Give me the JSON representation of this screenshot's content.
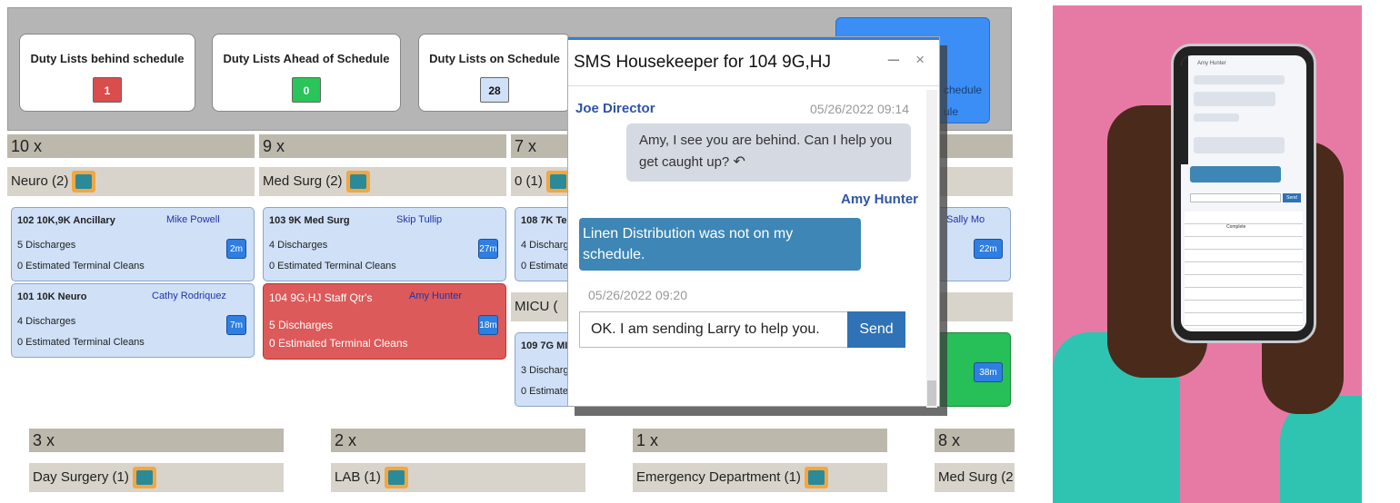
{
  "stats": [
    {
      "label": "Duty Lists behind schedule",
      "count": "1",
      "color": "#d94d4d"
    },
    {
      "label": "Duty Lists Ahead of Schedule",
      "count": "0",
      "color": "#29c45a"
    },
    {
      "label": "Duty Lists on Schedule",
      "count": "28",
      "color": "#cfe0f7"
    }
  ],
  "blue_button": {
    "line1": "chedule",
    "line2": "ule"
  },
  "groups": [
    {
      "multiplier": "10 x",
      "unit": "Neuro (2)"
    },
    {
      "multiplier": "9 x",
      "unit": "Med Surg (2)"
    },
    {
      "multiplier": "7 x",
      "unit": "0 (1)"
    }
  ],
  "lower_groups": [
    {
      "multiplier": "3 x",
      "unit": "Day Surgery (1)"
    },
    {
      "multiplier": "2 x",
      "unit": "LAB (1)"
    },
    {
      "multiplier": "1 x",
      "unit": "Emergency Department (1)"
    },
    {
      "multiplier": "8 x",
      "unit": "Med Surg (2"
    }
  ],
  "micu_label": "MICU (",
  "cards": [
    {
      "title": "102 10K,9K Ancillary",
      "who": "Mike Powell",
      "line1": "5 Discharges",
      "line2": "0 Estimated Terminal Cleans",
      "time": "2m"
    },
    {
      "title": "101 10K Neuro",
      "who": "Cathy Rodriquez",
      "line1": "4 Discharges",
      "line2": "0 Estimated Terminal Cleans",
      "time": "7m"
    },
    {
      "title": "103 9K Med Surg",
      "who": "Skip Tullip",
      "line1": "4 Discharges",
      "line2": "0 Estimated Terminal Cleans",
      "time": "27m"
    },
    {
      "title": "104 9G,HJ Staff Qtr's",
      "who": "Amy Hunter",
      "line1": "5 Discharges",
      "line2": "0 Estimated Terminal Cleans",
      "time": "18m"
    },
    {
      "title": "108 7K Tel",
      "who": "",
      "line1": "4 Discharg",
      "line2": "0 Estimate",
      "time": ""
    },
    {
      "title": "",
      "who": "Sally Mo",
      "line1": "",
      "line2": "",
      "time": "22m"
    },
    {
      "title": "109 7G MI",
      "who": "",
      "line1": "3 Discharg",
      "line2": "0 Estimate",
      "time": ""
    },
    {
      "title": "",
      "who": "",
      "line1": "",
      "line2": "",
      "time": "38m"
    }
  ],
  "chat": {
    "title": "SMS Housekeeper for 104 9G,HJ",
    "minimize": "–",
    "close": "×",
    "msg1_sender": "Joe Director",
    "msg1_time": "05/26/2022 09:14",
    "msg1_text": "Amy, I see you are behind. Can I help you get caught up?",
    "msg2_sender": "Amy Hunter",
    "msg2_text": "Linen Distribution was not on my schedule.",
    "msg2_time": "05/26/2022 09:20",
    "input_value": "OK. I am sending Larry to help you.",
    "send_label": "Send"
  },
  "phone_screen": {
    "contact": "Amy Hunter",
    "send_label": "Send",
    "complete_label": "Complete"
  },
  "colors": {
    "accent": "#2f72b5",
    "behind": "#dc5a5a",
    "ahead": "#27bf57",
    "on_schedule": "#cfe0f7",
    "photo_bg": "#e77aa5"
  }
}
